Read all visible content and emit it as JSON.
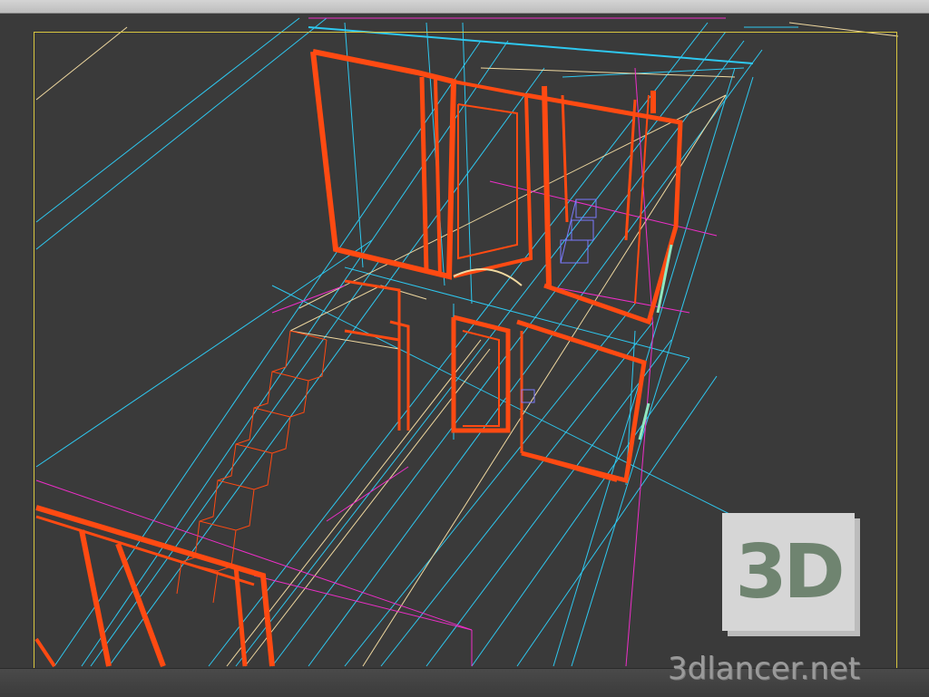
{
  "watermark": {
    "badge": "3D",
    "site": "3dlancer.net"
  },
  "colors": {
    "viewport_bg": "#3a3a3a",
    "frame": "#d8c640",
    "wall_wire": "#ff4a12",
    "glass_wire": "#2ec8f0",
    "trim_wire": "#ee2ec8",
    "beam_wire": "#f0d9a0",
    "furniture_wire": "#7a7aff",
    "accent_wire": "#8fe8c0"
  }
}
